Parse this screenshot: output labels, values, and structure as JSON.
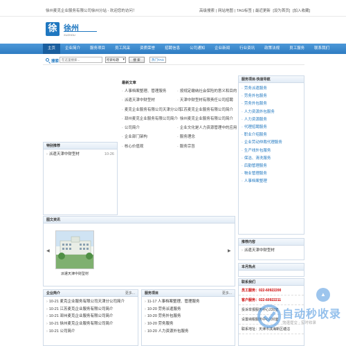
{
  "topbar": {
    "welcome": "徐州麦克企业服务有限公司徐州分站 - 欢迎您的访问！",
    "links": [
      "高级搜索",
      "网站地图",
      "TAG标签",
      "最近更新",
      "[设为首页]",
      "[加入收藏]"
    ]
  },
  "logo": {
    "city": "徐州",
    "glyph": "徐",
    "sub": "XUZHOU"
  },
  "nav": {
    "items": [
      "主页",
      "企业简介",
      "服务项目",
      "员工风采",
      "资质荣誉",
      "招聘信息",
      "公司通知",
      "企业新闻",
      "行业资讯",
      "政策法规",
      "员工服务",
      "联系我们"
    ],
    "active": 0
  },
  "search": {
    "label": "搜索",
    "placeholder": "在这里搜索...",
    "select_value": "检索标题",
    "button": "搜 索",
    "tag_button": "热门TAG"
  },
  "latest": {
    "title": "最新文章",
    "left": [
      "人事档案整理、管理服务",
      "派遣天津中财型材",
      "麦克企业服务有限公司天津分公司",
      "邳州麦克企业服务有限公司简介",
      "公司简介",
      "企业部门架构",
      "核心价值观"
    ],
    "right": [
      "按规定缴纳社会保险的意义和目的",
      "天津中财型材有限责任公司招聘",
      "江苏麦克企业服务有限公司简介",
      "徐州麦克企业服务有限公司简介",
      "企业文化是人力资源管理中的应用",
      "服务理念",
      "服务宗旨"
    ]
  },
  "special": {
    "title": "特别推荐",
    "items": [
      {
        "text": "派遣天津中财型材",
        "date": "10-26"
      }
    ]
  },
  "photo_news": {
    "title": "图文资讯",
    "caption": "派遣天津中财型材"
  },
  "company_intro": {
    "title": "企业简介",
    "more": "更多...",
    "items": [
      "10-21 麦克企业服务有限公司天津分公司简介",
      "10-21 江苏麦克企业服务有限公司简介",
      "10-21 邳州麦克企业服务有限公司简介",
      "10-21 徐州麦克企业服务有限公司简介",
      "10-21 公司简介"
    ]
  },
  "services": {
    "title": "服务项目",
    "more": "更多...",
    "items": [
      "11-17 人事档案整理、管理服务",
      "10-20 劳务派遣服务",
      "10-20 劳务外包服务",
      "10-20 劳务服务",
      "10-20 人力资源外包服务"
    ]
  },
  "service_nav": {
    "title": "服务项目-快速导航",
    "items": [
      "劳务派遣服务",
      "劳务外包服务",
      "劳务外包服务",
      "人力资源外包服务",
      "人力资源服务",
      "代理招聘服务",
      "职业介绍服务",
      "企业劳动仲裁代理服务",
      "生产线外包服务",
      "保洁、清洗服务",
      "后勤管理服务",
      "物业管理服务",
      "人事档案整理"
    ]
  },
  "recommend": {
    "title": "推荐内容",
    "items": [
      "派遣天津中财型材"
    ]
  },
  "hot": {
    "title": "本月热点"
  },
  "contact": {
    "title": "联系我们",
    "lines": [
      "员工服务：022-60922200",
      "客户服务：022-60922211",
      "投诉举报服务中心230室",
      "联系地址：天津市滨海新区塘沽"
    ],
    "extra": "设置纳税服务中心230室"
  },
  "watermark": {
    "text": "自动秒收录",
    "sub": "快速提交 · 实时收录"
  },
  "colors": {
    "primary": "#1f77c0",
    "nav": "#2e7cc2",
    "alert": "#cc0000"
  }
}
